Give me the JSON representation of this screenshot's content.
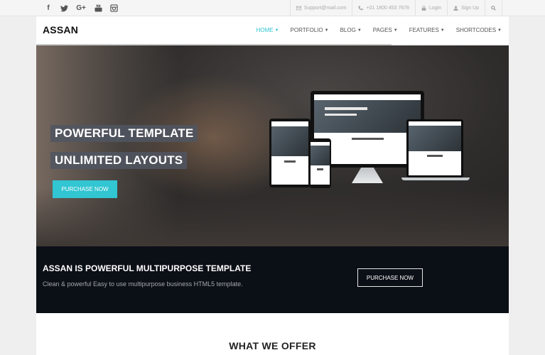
{
  "topbar": {
    "social_icons": [
      "facebook-icon",
      "twitter-icon",
      "google-plus-icon",
      "youtube-icon",
      "instagram-icon"
    ],
    "social_glyphs": {
      "facebook": "f",
      "google_plus": "G+"
    },
    "email": "Support@mail.com",
    "phone": "+01 1800 453 7678",
    "login": "Login",
    "signup": "Sign Up"
  },
  "navbar": {
    "logo": "ASSAN",
    "items": [
      {
        "label": "HOME",
        "active": true
      },
      {
        "label": "PORTFOLIO",
        "active": false
      },
      {
        "label": "BLOG",
        "active": false
      },
      {
        "label": "PAGES",
        "active": false
      },
      {
        "label": "FEATURES",
        "active": false
      },
      {
        "label": "SHORTCODES",
        "active": false
      }
    ],
    "accent": "#32c5d2"
  },
  "hero": {
    "headline_1": "POWERFUL TEMPLATE",
    "headline_2": "UNLIMITED LAYOUTS",
    "button_label": "PURCHASE NOW",
    "button_color": "#32c5d2"
  },
  "callout": {
    "title": "ASSAN IS POWERFUL MULTIPURPOSE TEMPLATE",
    "subtitle": "Clean & powerful Easy to use multipurpose business HTML5 template.",
    "button_label": "PURCHASE NOW",
    "background": "#0b0f16"
  },
  "offer": {
    "title": "WHAT WE OFFER"
  }
}
